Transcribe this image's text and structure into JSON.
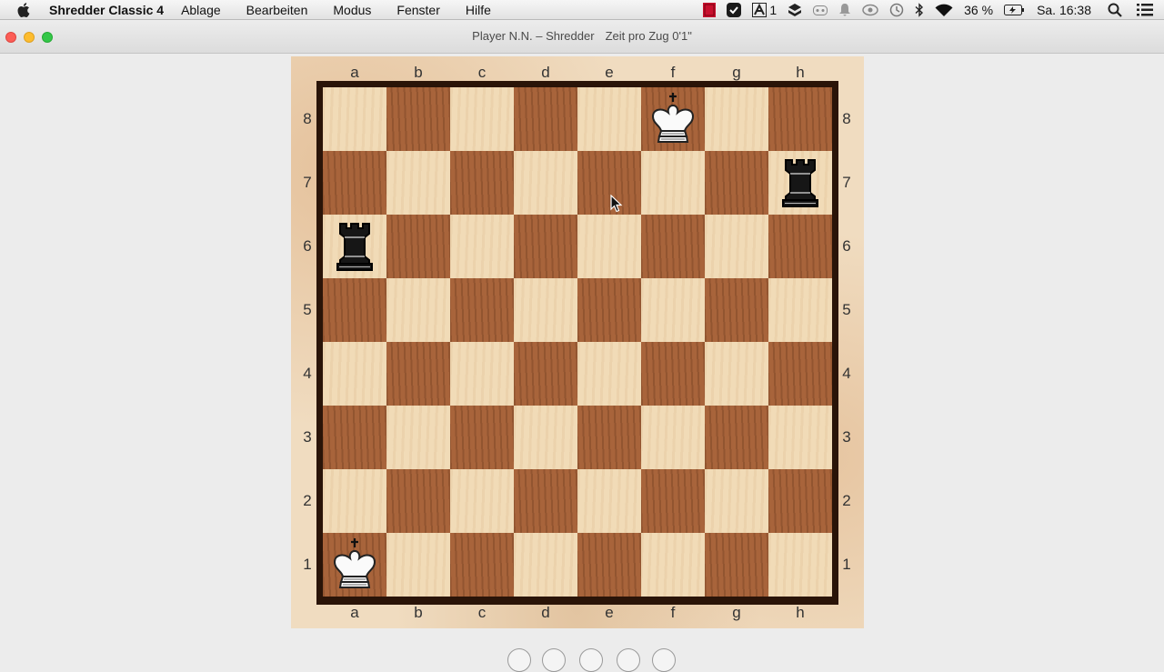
{
  "menubar": {
    "app_name": "Shredder Classic 4",
    "menus": [
      "Ablage",
      "Bearbeiten",
      "Modus",
      "Fenster",
      "Hilfe"
    ],
    "status": {
      "notification_count": "1",
      "battery": "36 %",
      "clock": "Sa. 16:38"
    },
    "icons": [
      "apple-icon",
      "stop-icon",
      "evernote-icon",
      "adobe-icon",
      "dropbox-icon",
      "gamepad-icon",
      "bell-icon",
      "eye-icon",
      "time-machine-icon",
      "bluetooth-icon",
      "wifi-icon",
      "battery-icon",
      "search-icon",
      "list-icon"
    ]
  },
  "window": {
    "title": "Player N.N. – Shredder",
    "time_control": "Zeit pro Zug 0'1\""
  },
  "board": {
    "files": [
      "a",
      "b",
      "c",
      "d",
      "e",
      "f",
      "g",
      "h"
    ],
    "ranks": [
      "8",
      "7",
      "6",
      "5",
      "4",
      "3",
      "2",
      "1"
    ],
    "light_color": "#f1dbb7",
    "dark_color": "#a8643b",
    "pieces": [
      {
        "square": "f8",
        "piece": "king",
        "color": "white"
      },
      {
        "square": "h7",
        "piece": "rook",
        "color": "black"
      },
      {
        "square": "a6",
        "piece": "rook",
        "color": "black"
      },
      {
        "square": "a1",
        "piece": "king",
        "color": "white"
      }
    ]
  },
  "controls": {
    "nav_buttons": [
      "first-move-button",
      "back-button",
      "play-button",
      "forward-button",
      "last-move-button"
    ]
  }
}
